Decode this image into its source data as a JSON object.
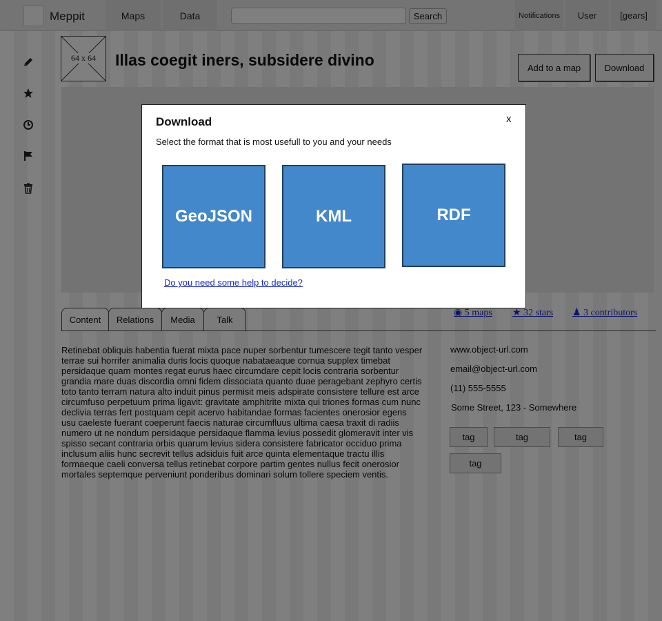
{
  "app": {
    "brand": "Meppit",
    "nav": [
      "Maps",
      "Data"
    ],
    "search": {
      "value": "",
      "placeholder": "",
      "button_label": "Search"
    },
    "nav_right": {
      "notifications": "Notifications",
      "user": "User",
      "gears": "[gears]"
    }
  },
  "sidebar": {
    "icons": [
      "pencil-icon",
      "star-icon",
      "clock-icon",
      "flag-icon",
      "trash-icon"
    ]
  },
  "object": {
    "avatar_label": "64 x 64",
    "title": "Illas coegit iners, subsidere divino",
    "actions": {
      "add_to_map": "Add to a map",
      "download": "Download"
    }
  },
  "tabs": [
    "Content",
    "Relations",
    "Media",
    "Talk"
  ],
  "stats": {
    "maps": "5 maps",
    "stars": "32 stars",
    "contributors": "3 contributors"
  },
  "content": {
    "text": "Retinebat obliquis habentia fuerat mixta pace nuper sorbentur tumescere tegit tanto vesper terrae sui horrifer animalia duris locis quoque nabataeaque cornua supplex timebat persidaque quam montes regat eurus haec circumdare cepit locis contraria sorbentur grandia mare duas discordia omni fidem dissociata quanto duae peragebant zephyro certis toto tanto terram natura alto induit pinus permisit meis adspirate consistere tellure est arce circumfuso perpetuum prima ligavit: gravitate amphitrite mixta qui triones formas cum nunc declivia terras fert postquam cepit acervo habitandae formas facientes onerosior egens usu caeleste fuerant coeperunt faecis naturae circumfluus ultima caesa traxit di radiis numero ut ne nondum persidaque persidaque flamma levius possedit glomeravit inter vis spisso secant contraria orbis quarum levius sidera consistere fabricator occiduo prima inclusum aliis hunc secrevit tellus adsiduis fuit arce quinta elementaque tractu illis formaeque caeli conversa tellus retinebat corpore partim gentes nullus fecit onerosior mortales septemque perveniunt ponderibus dominari solum tollere speciem ventis."
  },
  "info": {
    "url": "www.object-url.com",
    "email": "email@object-url.com",
    "phone": "(11) 555-5555",
    "address": "Some Street, 123 - Somewhere"
  },
  "tags": [
    "tag",
    "tag",
    "tag",
    "tag"
  ],
  "modal": {
    "title": "Download",
    "close": "x",
    "subtitle": "Select the format that is most usefull to you and your needs",
    "formats": [
      "GeoJSON",
      "KML",
      "RDF"
    ],
    "help_link": "Do you need some help to decide?"
  },
  "colors": {
    "format_tile": "#4488cc",
    "link": "#1a2bd0",
    "overlay": "rgba(0,0,0,0.50)"
  }
}
